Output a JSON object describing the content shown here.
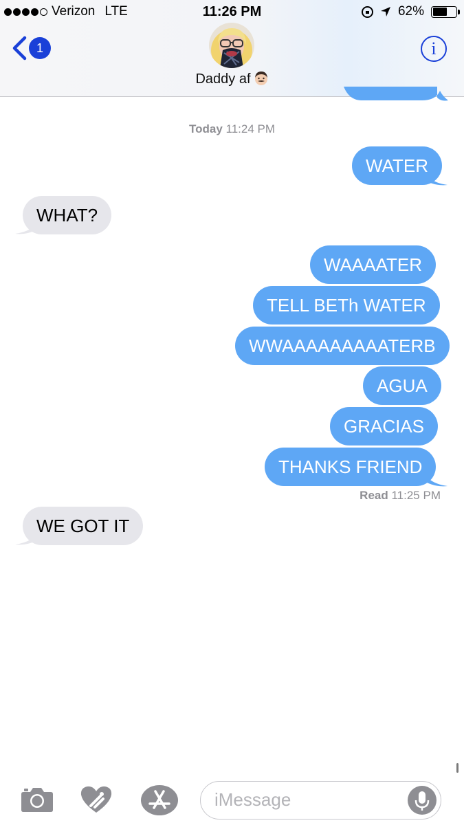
{
  "status_bar": {
    "carrier": "Verizon",
    "network": "LTE",
    "time": "11:26 PM",
    "battery": "62%",
    "battery_level": 0.62
  },
  "header": {
    "back_badge": "1",
    "contact_name": "Daddy af",
    "info_label": "i"
  },
  "conversation": {
    "timestamp_day": "Today",
    "timestamp_time": "11:24 PM",
    "messages": [
      {
        "direction": "outgoing",
        "text": "WATER"
      },
      {
        "direction": "incoming",
        "text": "WHAT?"
      },
      {
        "direction": "outgoing",
        "text": "WAAAATER"
      },
      {
        "direction": "outgoing",
        "text": "TELL BETh WATER"
      },
      {
        "direction": "outgoing",
        "text": "WWAAAAAAAAATERB"
      },
      {
        "direction": "outgoing",
        "text": "AGUA"
      },
      {
        "direction": "outgoing",
        "text": "GRACIAS"
      },
      {
        "direction": "outgoing",
        "text": "THANKS FRIEND"
      },
      {
        "direction": "incoming",
        "text": "WE GOT IT"
      }
    ],
    "read_label": "Read",
    "read_time": "11:25 PM"
  },
  "input_bar": {
    "placeholder": "iMessage"
  },
  "colors": {
    "outgoing_bubble": "#5ea7f5",
    "incoming_bubble": "#e6e6eb",
    "accent": "#1a40d8",
    "meta_text": "#8e8e93"
  }
}
